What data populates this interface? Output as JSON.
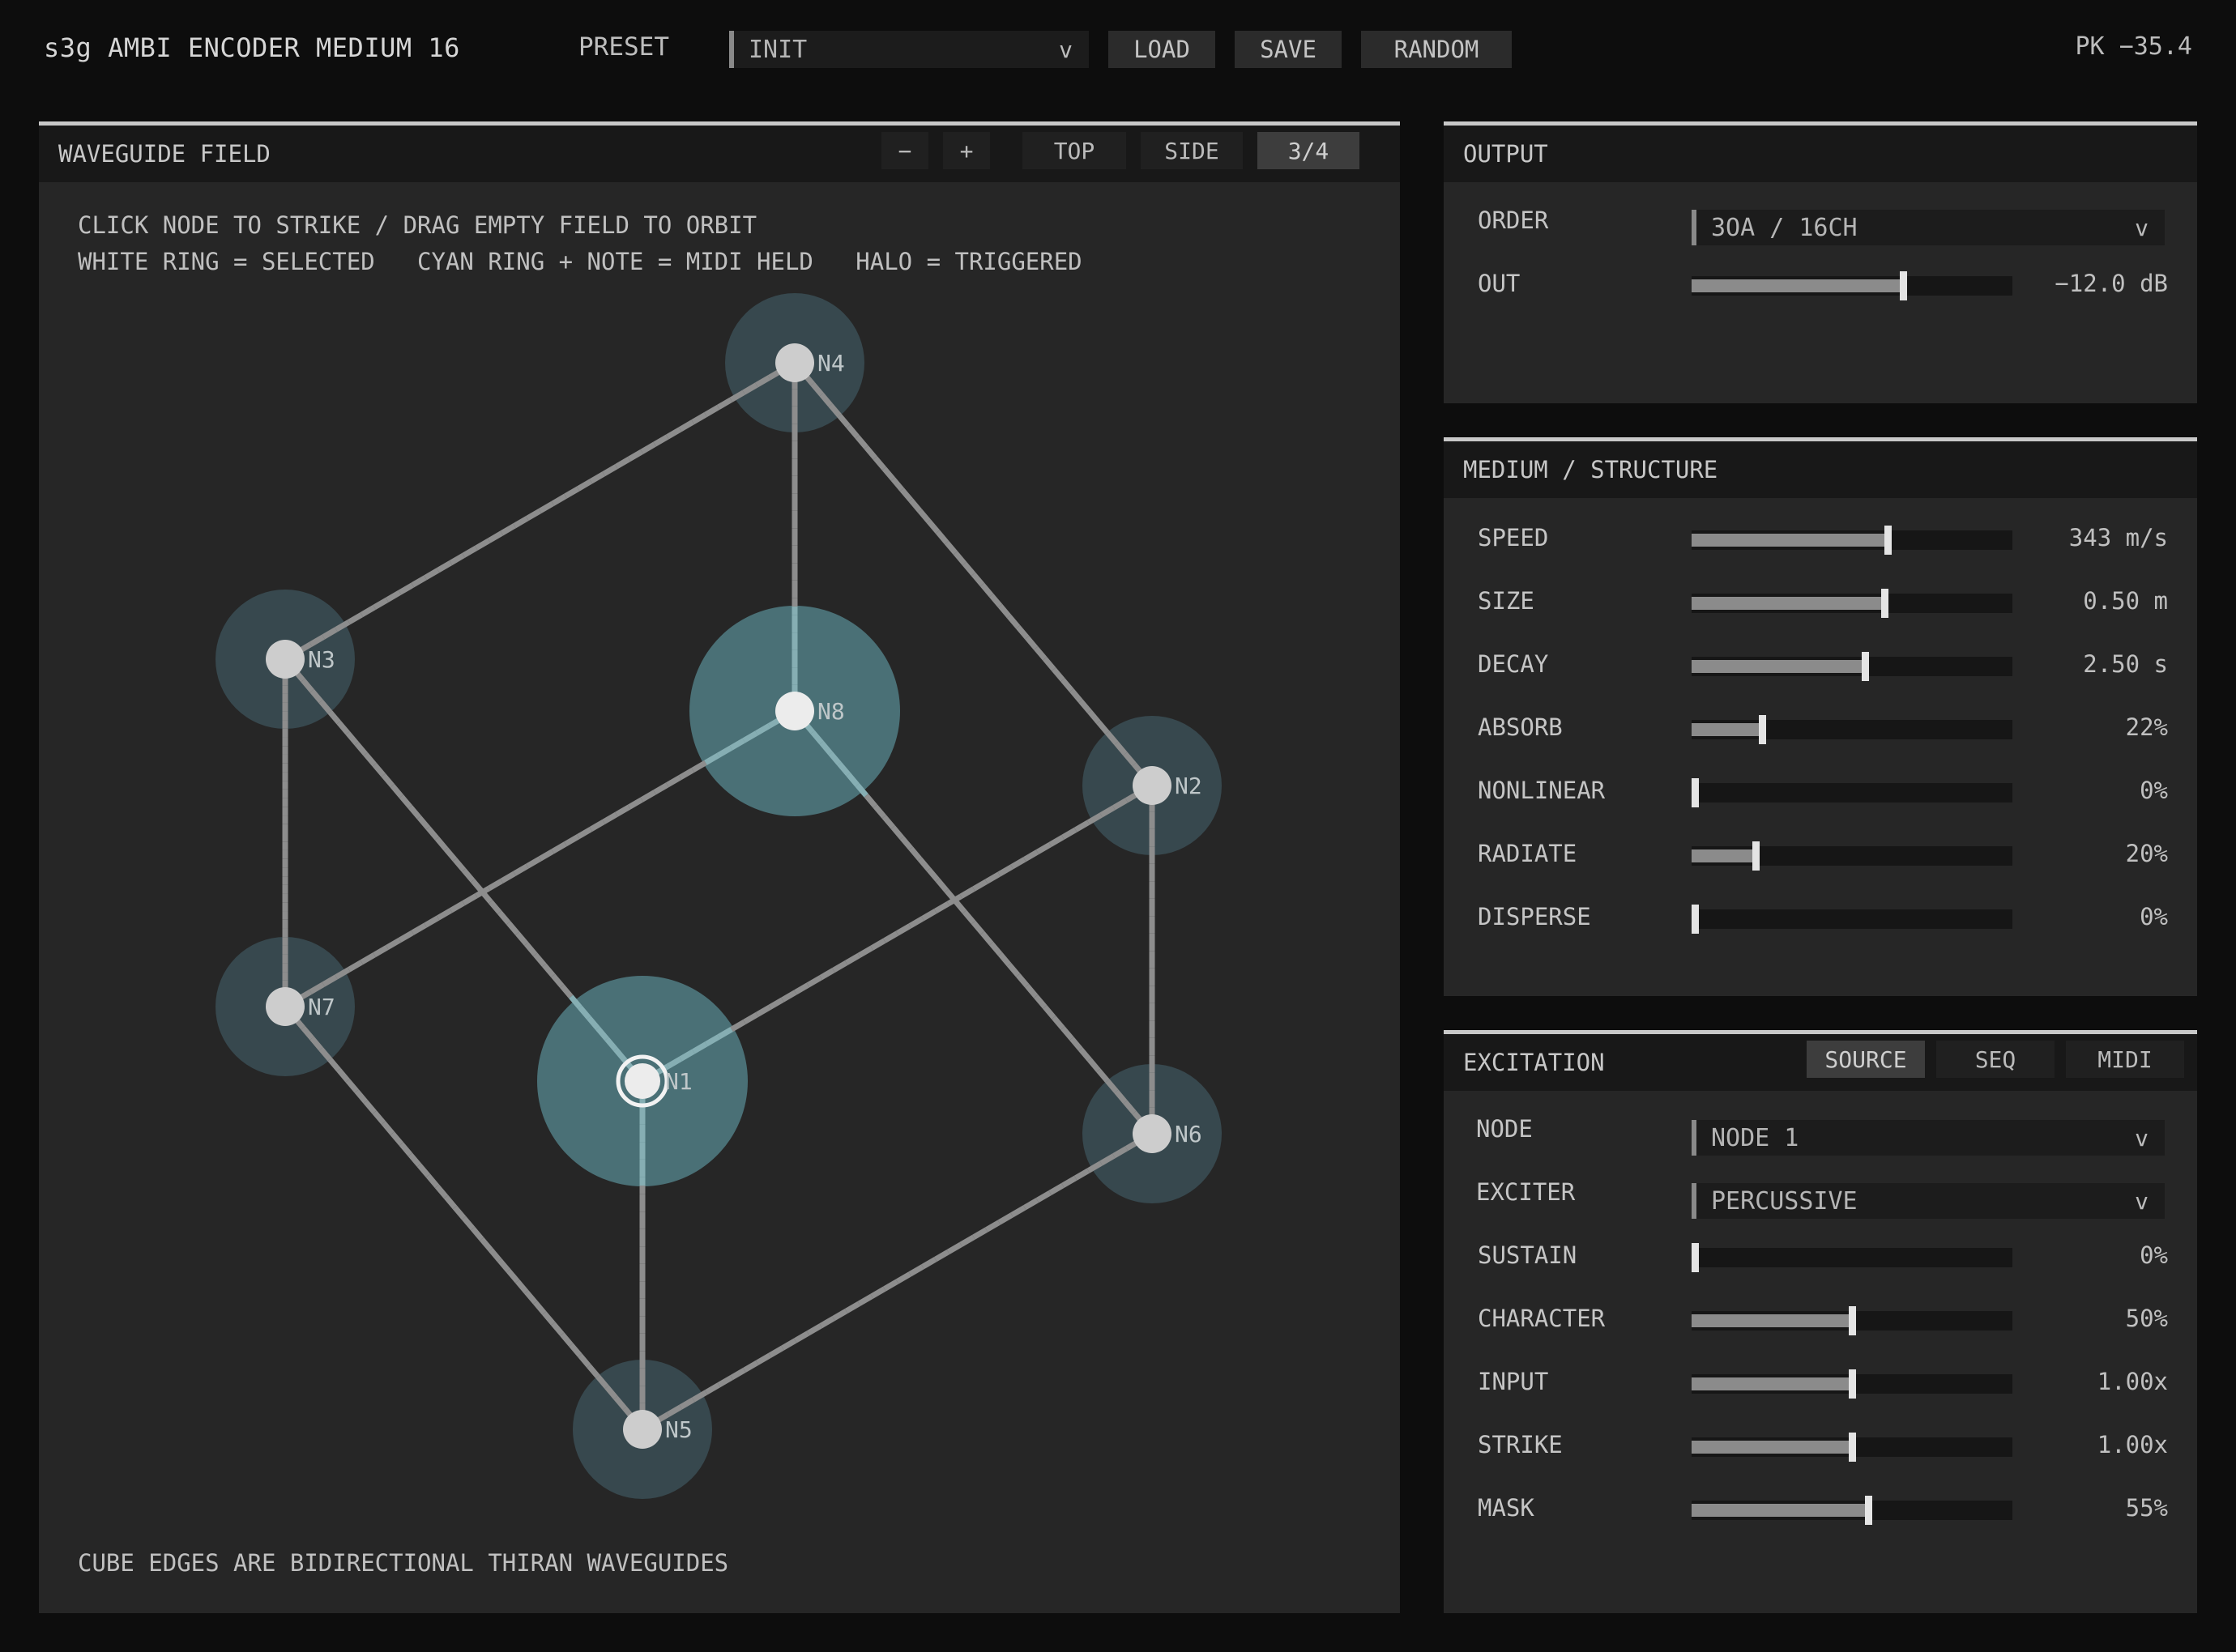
{
  "header": {
    "title": "s3g AMBI ENCODER MEDIUM 16",
    "preset_label": "PRESET",
    "preset_value": "INIT",
    "chevron": "v",
    "load_label": "LOAD",
    "save_label": "SAVE",
    "random_label": "RANDOM",
    "peak": "PK −35.4"
  },
  "field": {
    "title": "WAVEGUIDE FIELD",
    "zoom_out": "−",
    "zoom_in": "+",
    "views": [
      "TOP",
      "SIDE",
      "3/4"
    ],
    "active_view": "3/4",
    "hint1": "CLICK NODE TO STRIKE / DRAG EMPTY FIELD TO ORBIT",
    "hint2": "WHITE RING = SELECTED   CYAN RING + NOTE = MIDI HELD   HALO = TRIGGERED",
    "footer": "CUBE EDGES ARE BIDIRECTIONAL THIRAN WAVEGUIDES",
    "selected_node": "N1",
    "nodes": [
      {
        "id": "N1",
        "label": "N1",
        "halo": "large"
      },
      {
        "id": "N2",
        "label": "N2",
        "halo": "small"
      },
      {
        "id": "N3",
        "label": "N3",
        "halo": "small"
      },
      {
        "id": "N4",
        "label": "N4",
        "halo": "small"
      },
      {
        "id": "N5",
        "label": "N5",
        "halo": "small"
      },
      {
        "id": "N6",
        "label": "N6",
        "halo": "small"
      },
      {
        "id": "N7",
        "label": "N7",
        "halo": "small"
      },
      {
        "id": "N8",
        "label": "N8",
        "halo": "large"
      }
    ],
    "edges": [
      [
        "N3",
        "N4"
      ],
      [
        "N4",
        "N2"
      ],
      [
        "N4",
        "N8"
      ],
      [
        "N3",
        "N1"
      ],
      [
        "N8",
        "N7"
      ],
      [
        "N8",
        "N6"
      ],
      [
        "N1",
        "N2"
      ],
      [
        "N3",
        "N7"
      ],
      [
        "N2",
        "N6"
      ],
      [
        "N7",
        "N5"
      ],
      [
        "N1",
        "N5"
      ],
      [
        "N6",
        "N5"
      ]
    ]
  },
  "output": {
    "title": "OUTPUT",
    "order_label": "ORDER",
    "order_value": "3OA / 16CH",
    "out_label": "OUT",
    "out_value": "−12.0 dB",
    "out_level": 0.66
  },
  "medium": {
    "title": "MEDIUM / STRUCTURE",
    "params": [
      {
        "label": "SPEED",
        "value": "343 m/s",
        "level": 0.61
      },
      {
        "label": "SIZE",
        "value": "0.50 m",
        "level": 0.6
      },
      {
        "label": "DECAY",
        "value": "2.50 s",
        "level": 0.54
      },
      {
        "label": "ABSORB",
        "value": "22%",
        "level": 0.22
      },
      {
        "label": "NONLINEAR",
        "value": "0%",
        "level": 0.0
      },
      {
        "label": "RADIATE",
        "value": "20%",
        "level": 0.2
      },
      {
        "label": "DISPERSE",
        "value": "0%",
        "level": 0.0
      }
    ]
  },
  "excitation": {
    "title": "EXCITATION",
    "tabs": [
      "SOURCE",
      "SEQ",
      "MIDI"
    ],
    "active_tab": "SOURCE",
    "node_label": "NODE",
    "node_value": "NODE 1",
    "exciter_label": "EXCITER",
    "exciter_value": "PERCUSSIVE",
    "params": [
      {
        "label": "SUSTAIN",
        "value": "0%",
        "level": 0.0
      },
      {
        "label": "CHARACTER",
        "value": "50%",
        "level": 0.5
      },
      {
        "label": "INPUT",
        "value": "1.00x",
        "level": 0.5
      },
      {
        "label": "STRIKE",
        "value": "1.00x",
        "level": 0.5
      },
      {
        "label": "MASK",
        "value": "55%",
        "level": 0.55
      }
    ]
  },
  "colors": {
    "halo_large": "#4a7076",
    "halo_small": "#37484e",
    "edge": "#8d8d8d",
    "edge_highlight": "#86aeb3",
    "node": "#cdcdcd"
  }
}
